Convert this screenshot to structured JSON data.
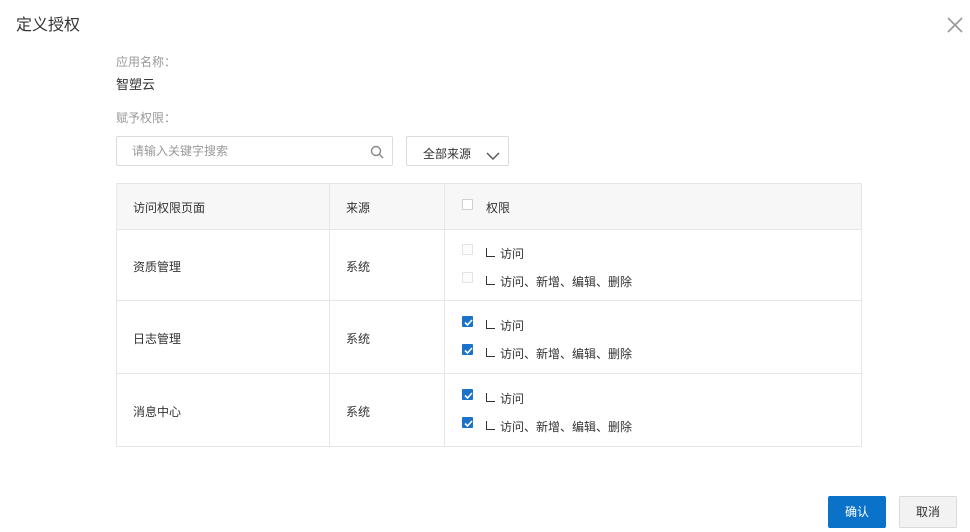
{
  "dialog": {
    "title": "定义授权"
  },
  "app": {
    "label": "应用名称：",
    "value": "智塑云"
  },
  "grant": {
    "label": "赋予权限："
  },
  "search": {
    "placeholder": "请输入关键字搜索"
  },
  "source_filter": {
    "selected": "全部来源"
  },
  "table": {
    "headers": {
      "page": "访问权限页面",
      "source": "来源",
      "permission": "权限"
    },
    "header_checkbox_checked": false,
    "rows": [
      {
        "page": "资质管理",
        "source": "系统",
        "perms": [
          {
            "label": "访问",
            "checked": false,
            "disabled": true
          },
          {
            "label": "访问、新增、编辑、删除",
            "checked": false,
            "disabled": true
          }
        ]
      },
      {
        "page": "日志管理",
        "source": "系统",
        "perms": [
          {
            "label": "访问",
            "checked": true,
            "disabled": false
          },
          {
            "label": "访问、新增、编辑、删除",
            "checked": true,
            "disabled": false
          }
        ]
      },
      {
        "page": "消息中心",
        "source": "系统",
        "perms": [
          {
            "label": "访问",
            "checked": true,
            "disabled": false
          },
          {
            "label": "访问、新增、编辑、删除",
            "checked": true,
            "disabled": false
          }
        ]
      }
    ]
  },
  "footer": {
    "confirm_label": "确认",
    "cancel_label": "取消"
  },
  "colors": {
    "primary": "#0b72c9",
    "checkbox_checked": "#1a73c8"
  }
}
